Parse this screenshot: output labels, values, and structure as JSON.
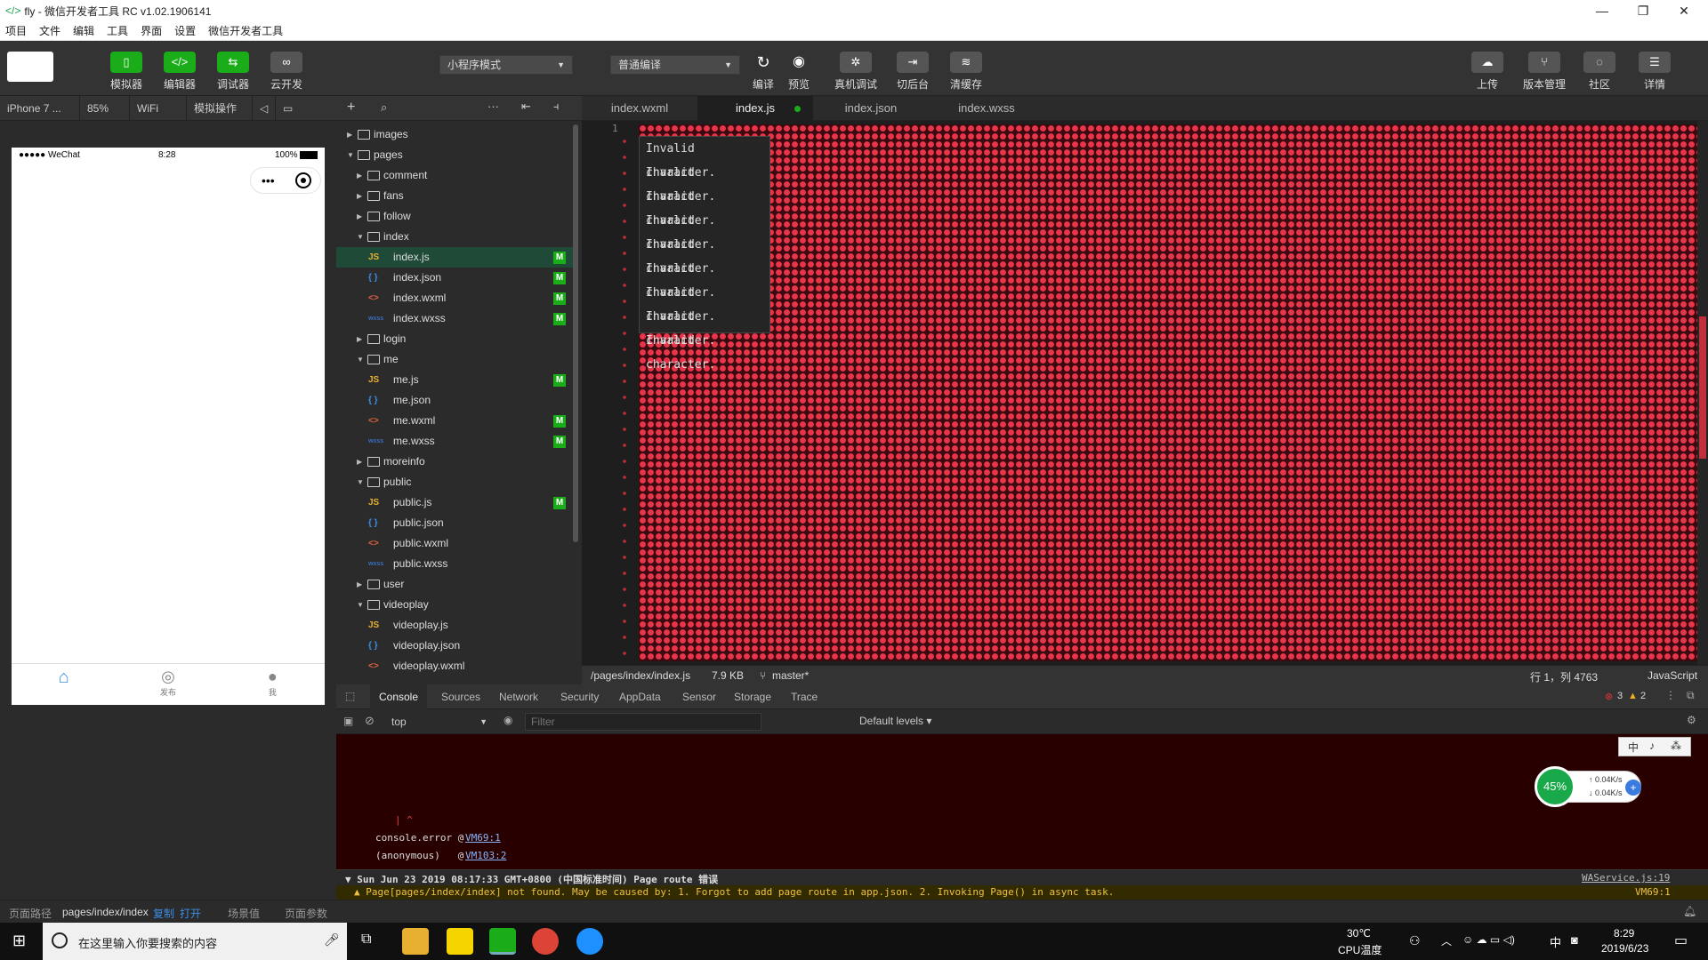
{
  "window": {
    "title": "fly - 微信开发者工具 RC v1.02.1906141",
    "minimize": "—",
    "maximize": "❐",
    "close": "✕"
  },
  "menu": [
    "项目",
    "文件",
    "编辑",
    "工具",
    "界面",
    "设置",
    "微信开发者工具"
  ],
  "toolbar": {
    "buttons": {
      "simulator": "模拟器",
      "editor": "编辑器",
      "debugger": "调试器",
      "cloud": "云开发",
      "compile": "编译",
      "preview": "预览",
      "remote_debug": "真机调试",
      "background": "切后台",
      "clear_cache": "清缓存",
      "upload": "上传",
      "version": "版本管理",
      "community": "社区",
      "details": "详情"
    },
    "mode_select": "小程序模式",
    "compile_select": "普通编译"
  },
  "simbar": {
    "device": "iPhone 7 ...",
    "zoom": "85%",
    "network": "WiFi",
    "ops": "模拟操作"
  },
  "phone": {
    "carrier": "●●●●● WeChat",
    "time": "8:28",
    "battery": "100%",
    "tabs": [
      "",
      "发布",
      "我"
    ]
  },
  "filetree": {
    "items": [
      {
        "label": "images",
        "type": "folder",
        "depth": 0,
        "open": false,
        "badge": ""
      },
      {
        "label": "pages",
        "type": "folder",
        "depth": 0,
        "open": true,
        "badge": ""
      },
      {
        "label": "comment",
        "type": "folder",
        "depth": 1,
        "open": false,
        "badge": ""
      },
      {
        "label": "fans",
        "type": "folder",
        "depth": 1,
        "open": false,
        "badge": ""
      },
      {
        "label": "follow",
        "type": "folder",
        "depth": 1,
        "open": false,
        "badge": ""
      },
      {
        "label": "index",
        "type": "folder",
        "depth": 1,
        "open": true,
        "badge": ""
      },
      {
        "label": "index.js",
        "type": "js",
        "depth": 2,
        "badge": "M",
        "selected": true
      },
      {
        "label": "index.json",
        "type": "json",
        "depth": 2,
        "badge": "M"
      },
      {
        "label": "index.wxml",
        "type": "wxml",
        "depth": 2,
        "badge": "M"
      },
      {
        "label": "index.wxss",
        "type": "wxss",
        "depth": 2,
        "badge": "M"
      },
      {
        "label": "login",
        "type": "folder",
        "depth": 1,
        "open": false,
        "badge": ""
      },
      {
        "label": "me",
        "type": "folder",
        "depth": 1,
        "open": true,
        "badge": ""
      },
      {
        "label": "me.js",
        "type": "js",
        "depth": 2,
        "badge": "M"
      },
      {
        "label": "me.json",
        "type": "json",
        "depth": 2,
        "badge": ""
      },
      {
        "label": "me.wxml",
        "type": "wxml",
        "depth": 2,
        "badge": "M"
      },
      {
        "label": "me.wxss",
        "type": "wxss",
        "depth": 2,
        "badge": "M"
      },
      {
        "label": "moreinfo",
        "type": "folder",
        "depth": 1,
        "open": false,
        "badge": ""
      },
      {
        "label": "public",
        "type": "folder",
        "depth": 1,
        "open": true,
        "badge": ""
      },
      {
        "label": "public.js",
        "type": "js",
        "depth": 2,
        "badge": "M"
      },
      {
        "label": "public.json",
        "type": "json",
        "depth": 2,
        "badge": ""
      },
      {
        "label": "public.wxml",
        "type": "wxml",
        "depth": 2,
        "badge": ""
      },
      {
        "label": "public.wxss",
        "type": "wxss",
        "depth": 2,
        "badge": ""
      },
      {
        "label": "user",
        "type": "folder",
        "depth": 1,
        "open": false,
        "badge": ""
      },
      {
        "label": "videoplay",
        "type": "folder",
        "depth": 1,
        "open": true,
        "badge": ""
      },
      {
        "label": "videoplay.js",
        "type": "js",
        "depth": 2,
        "badge": ""
      },
      {
        "label": "videoplay.json",
        "type": "json",
        "depth": 2,
        "badge": ""
      },
      {
        "label": "videoplay.wxml",
        "type": "wxml",
        "depth": 2,
        "badge": ""
      }
    ]
  },
  "editor_tabs": [
    "index.wxml",
    "index.js",
    "index.json",
    "index.wxss"
  ],
  "editor": {
    "line_number": "1",
    "errors": [
      "Invalid character.",
      "Invalid character.",
      "Invalid character.",
      "Invalid character.",
      "Invalid character.",
      "Invalid character.",
      "Invalid character.",
      "Invalid character.",
      "Invalid character."
    ]
  },
  "edstatus": {
    "path": "/pages/index/index.js",
    "size": "7.9 KB",
    "branch": "master*",
    "position": "行 1，列 4763",
    "language": "JavaScript"
  },
  "devtools": {
    "tabs": [
      "Console",
      "Sources",
      "Network",
      "Security",
      "AppData",
      "Sensor",
      "Storage",
      "Trace"
    ],
    "errors": "3",
    "warnings": "2",
    "context": "top",
    "filter_placeholder": "Filter",
    "levels": "Default levels ▾"
  },
  "console": {
    "caret": "| ^",
    "line1": "console.error @",
    "link1": "VM69:1",
    "line2": "(anonymous)   @",
    "link2": "VM103:2",
    "route_line": "▼ Sun Jun 23 2019 08:17:33 GMT+0800 (中国标准时间) Page route 错误",
    "route_link": "WAService.js:19",
    "warn_line": "▲ Page[pages/index/index] not found. May be caused by: 1. Forgot to add page route in app.json. 2. Invoking Page() in async task.",
    "warn_link": "VM69:1"
  },
  "netwidget": {
    "percent": "45%",
    "up": "↑ 0.04K/s",
    "down": "↓ 0.04K/s"
  },
  "ime": [
    "中",
    "♪",
    "⁂"
  ],
  "pagebar": {
    "route_label": "页面路径",
    "route": "pages/index/index",
    "copy": "复制",
    "open": "打开",
    "scene": "场景值",
    "params": "页面参数"
  },
  "taskbar": {
    "search_placeholder": "在这里输入你要搜索的内容",
    "temp": "30℃",
    "temp_label": "CPU温度",
    "ime": "中",
    "time": "8:29",
    "date": "2019/6/23"
  },
  "colors": {
    "accent": "#1aad19",
    "error_red": "#e8354a",
    "console_bg": "#280000"
  }
}
